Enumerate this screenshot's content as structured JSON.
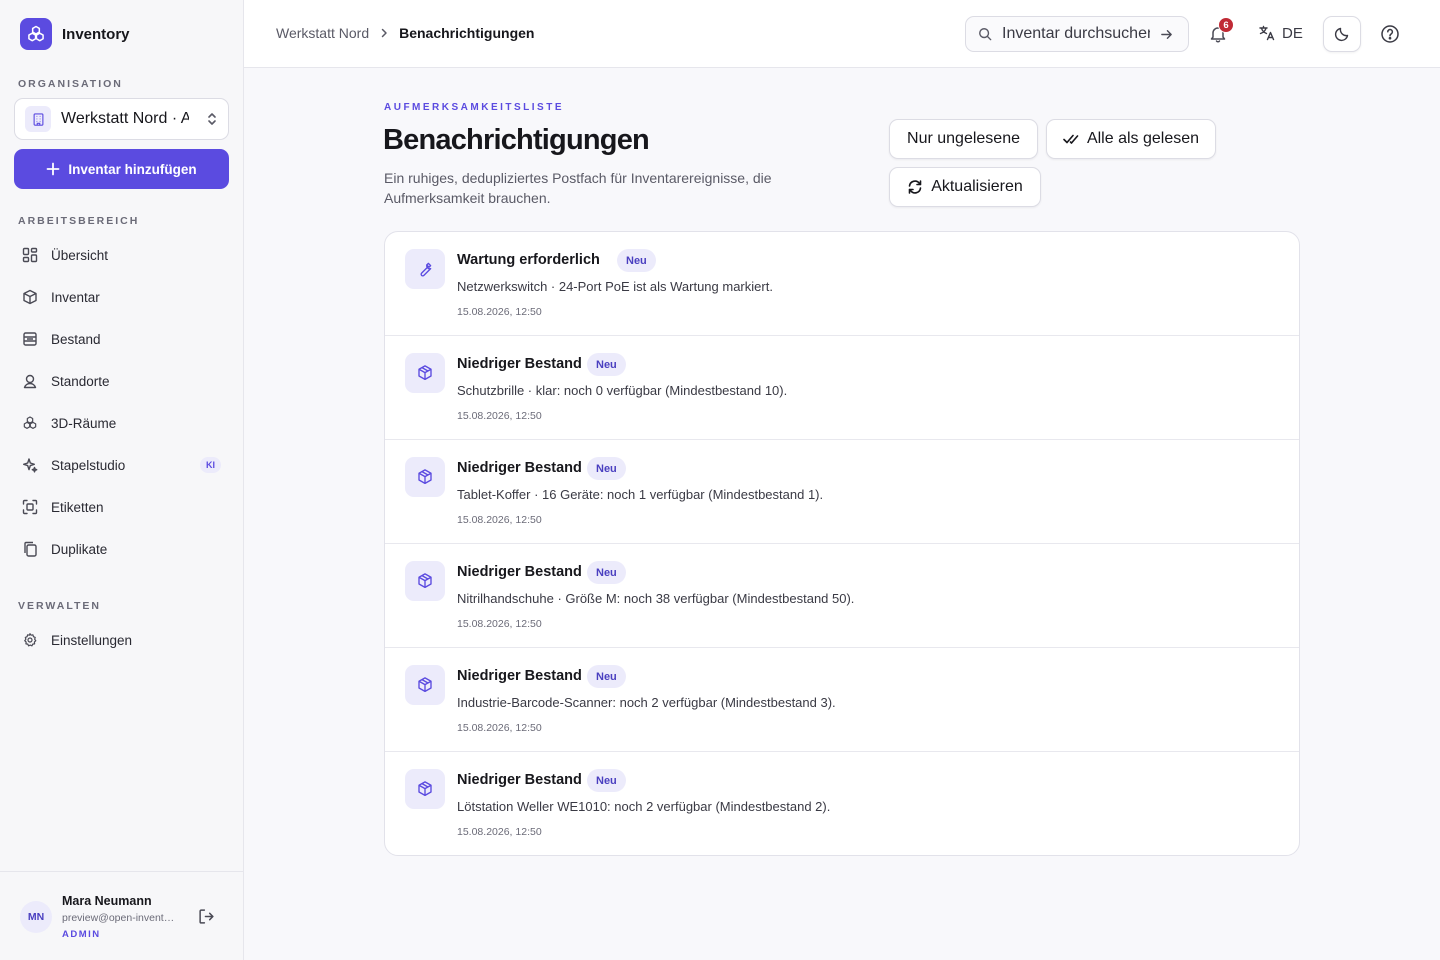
{
  "app": {
    "name": "Inventory"
  },
  "sidebar": {
    "org_section_label": "ORGANISATION",
    "org_selected": "Werkstatt Nord · Arbeitsbereich",
    "add_button_label": "Inventar hinzufügen",
    "workspace_section_label": "ARBEITSBEREICH",
    "items": [
      {
        "label": "Übersicht",
        "icon": "dashboard-icon"
      },
      {
        "label": "Inventar",
        "icon": "box-icon"
      },
      {
        "label": "Bestand",
        "icon": "stock-icon"
      },
      {
        "label": "Standorte",
        "icon": "location-icon"
      },
      {
        "label": "3D-Räume",
        "icon": "cubes-icon"
      },
      {
        "label": "Stapelstudio",
        "icon": "sparkle-icon",
        "badge": "KI"
      },
      {
        "label": "Etiketten",
        "icon": "scan-icon"
      },
      {
        "label": "Duplikate",
        "icon": "copy-icon"
      }
    ],
    "manage_section_label": "VERWALTEN",
    "manage_items": [
      {
        "label": "Einstellungen",
        "icon": "gear-icon"
      }
    ],
    "user": {
      "initials": "MN",
      "name": "Mara Neumann",
      "email": "preview@open-inventory.app",
      "role": "ADMIN"
    }
  },
  "topbar": {
    "breadcrumb": [
      "Werkstatt Nord",
      "Benachrichtigungen"
    ],
    "search_placeholder": "Inventar durchsuchen",
    "notification_count": "6",
    "language": "DE"
  },
  "main": {
    "eyebrow": "AUFMERKSAMKEITSLISTE",
    "title": "Benachrichtigungen",
    "description": "Ein ruhiges, dedupliziertes Postfach für Inventarereignisse, die Aufmerksamkeit brauchen.",
    "buttons": {
      "unread_only": "Nur ungelesene",
      "mark_all_read": "Alle als gelesen",
      "refresh": "Aktualisieren"
    },
    "notifications": [
      {
        "title": "Wartung erforderlich",
        "badge": "Neu",
        "message": "Netzwerkswitch · 24-Port PoE ist als Wartung markiert.",
        "time": "15.08.2026, 12:50",
        "icon": "wrench-icon"
      },
      {
        "title": "Niedriger Bestand",
        "badge": "Neu",
        "message": "Schutzbrille · klar: noch 0 verfügbar (Mindestbestand 10).",
        "time": "15.08.2026, 12:50",
        "icon": "package-icon"
      },
      {
        "title": "Niedriger Bestand",
        "badge": "Neu",
        "message": "Tablet-Koffer · 16 Geräte: noch 1 verfügbar (Mindestbestand 1).",
        "time": "15.08.2026, 12:50",
        "icon": "package-icon"
      },
      {
        "title": "Niedriger Bestand",
        "badge": "Neu",
        "message": "Nitrilhandschuhe · Größe M: noch 38 verfügbar (Mindestbestand 50).",
        "time": "15.08.2026, 12:50",
        "icon": "package-icon"
      },
      {
        "title": "Niedriger Bestand",
        "badge": "Neu",
        "message": "Industrie-Barcode-Scanner: noch 2 verfügbar (Mindestbestand 3).",
        "time": "15.08.2026, 12:50",
        "icon": "package-icon"
      },
      {
        "title": "Niedriger Bestand",
        "badge": "Neu",
        "message": "Lötstation Weller WE1010: noch 2 verfügbar (Mindestbestand 2).",
        "time": "15.08.2026, 12:50",
        "icon": "package-icon"
      }
    ]
  },
  "colors": {
    "accent": "#5b4be0",
    "accent_soft": "#ecebfb",
    "danger": "#c02a35",
    "sidebar_bg": "#f7f7f9",
    "page_bg": "#f8f8fb"
  }
}
